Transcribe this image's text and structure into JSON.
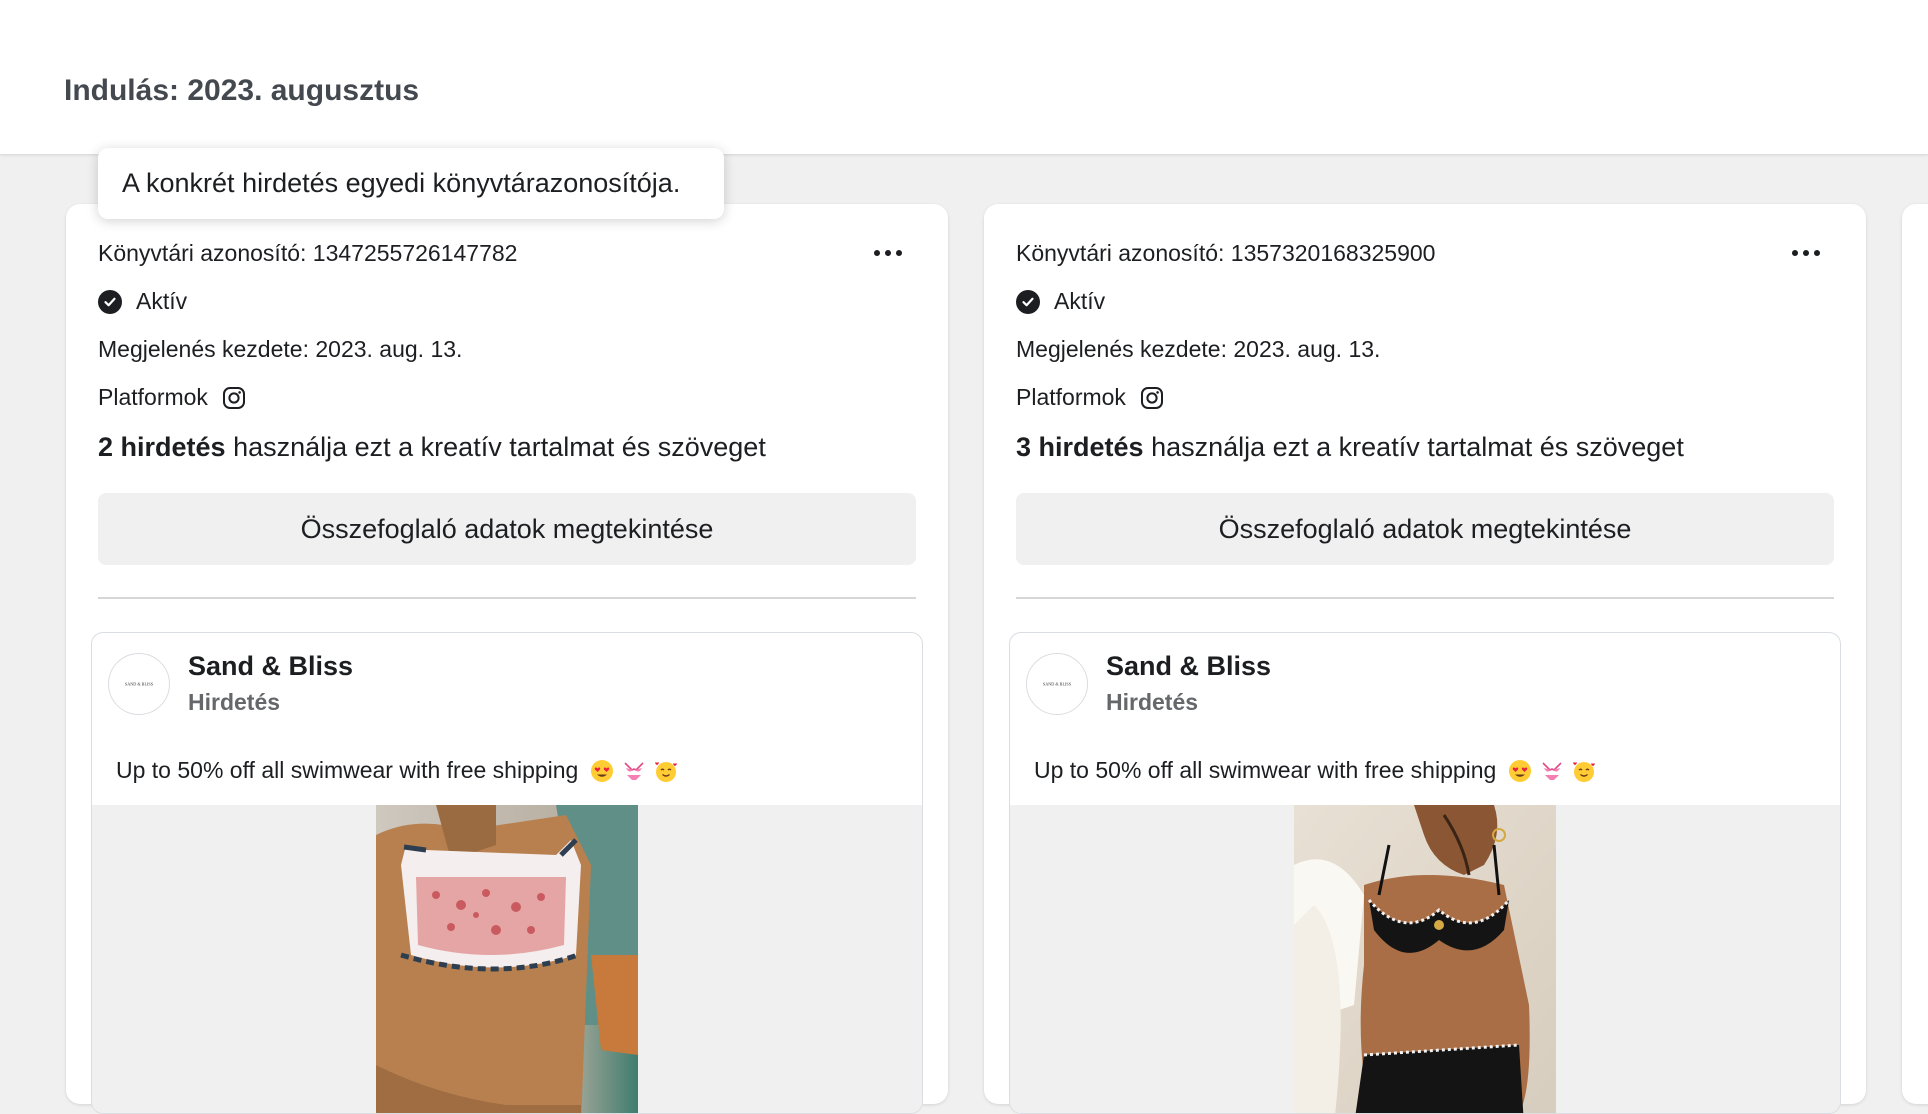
{
  "page": {
    "title": "Indulás: 2023. augusztus"
  },
  "tooltip": {
    "text": "A konkrét hirdetés egyedi könyvtárazonosítója."
  },
  "cards": [
    {
      "library_id": "Könyvtári azonosító: 1347255726147782",
      "status": "Aktív",
      "start_date": "Megjelenés kezdete: 2023. aug. 13.",
      "platforms_label": "Platformok",
      "usage_count": "2 hirdetés",
      "usage_rest": " használja ezt a kreatív tartalmat és szöveget",
      "summary_button": "Összefoglaló adatok megtekintése",
      "advertiser": "Sand & Bliss",
      "logo_text": "SAND & BLISS",
      "sponsored": "Hirdetés",
      "ad_text": "Up to 50% off all swimwear with free shipping",
      "emojis": [
        "heart-eyes-emoji",
        "bikini-emoji",
        "smiling-hearts-emoji"
      ]
    },
    {
      "library_id": "Könyvtári azonosító: 1357320168325900",
      "status": "Aktív",
      "start_date": "Megjelenés kezdete: 2023. aug. 13.",
      "platforms_label": "Platformok",
      "usage_count": "3 hirdetés",
      "usage_rest": " használja ezt a kreatív tartalmat és szöveget",
      "summary_button": "Összefoglaló adatok megtekintése",
      "advertiser": "Sand & Bliss",
      "logo_text": "SAND & BLISS",
      "sponsored": "Hirdetés",
      "ad_text": "Up to 50% off all swimwear with free shipping",
      "emojis": [
        "heart-eyes-emoji",
        "bikini-emoji",
        "smiling-hearts-emoji"
      ]
    }
  ],
  "icons": {
    "status": "check-circle-icon",
    "platform": "instagram-icon",
    "menu": "more-options-icon"
  }
}
